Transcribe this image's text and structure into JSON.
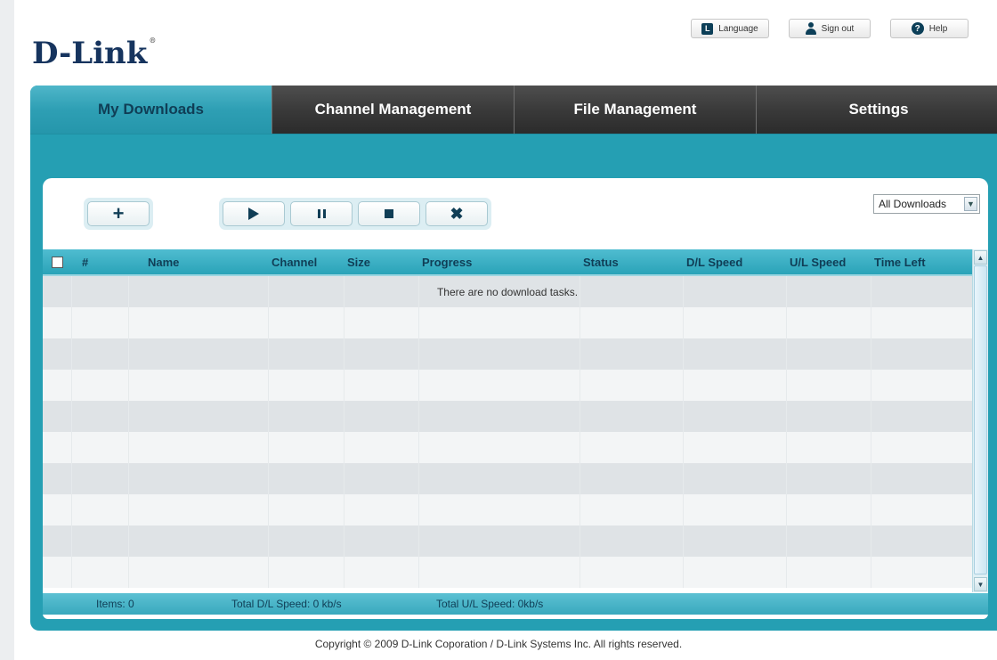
{
  "brand": {
    "logo": "D-Link",
    "reg": "®"
  },
  "top_links": {
    "language": "Language",
    "language_icon_glyph": "L",
    "signout": "Sign out",
    "help": "Help",
    "help_icon_glyph": "?"
  },
  "tabs": [
    {
      "label": "My Downloads",
      "active": true
    },
    {
      "label": "Channel Management",
      "active": false
    },
    {
      "label": "File Management",
      "active": false
    },
    {
      "label": "Settings",
      "active": false
    }
  ],
  "toolbar": {
    "add_icon": "plus-icon",
    "play_icon": "play-icon",
    "pause_icon": "pause-icon",
    "stop_icon": "stop-icon",
    "delete_icon": "close-icon",
    "plus_glyph": "+",
    "x_glyph": "✖"
  },
  "filter": {
    "selected": "All Downloads",
    "arrow_glyph": "▼"
  },
  "table": {
    "headers": [
      "#",
      "Name",
      "Channel",
      "Size",
      "Progress",
      "Status",
      "D/L Speed",
      "U/L Speed",
      "Time Left"
    ],
    "empty_message": "There are no download tasks."
  },
  "scrollbar": {
    "up_glyph": "▲",
    "down_glyph": "▼"
  },
  "footer": {
    "items": "Items: 0",
    "dl_speed": "Total D/L Speed: 0 kb/s",
    "ul_speed": "Total U/L Speed: 0kb/s"
  },
  "copyright": "Copyright © 2009 D-Link Coporation / D-Link Systems Inc. All rights reserved.",
  "colors": {
    "accent": "#259fb3",
    "tab_dark": "#3a3a3a",
    "text_dark": "#103e56"
  }
}
